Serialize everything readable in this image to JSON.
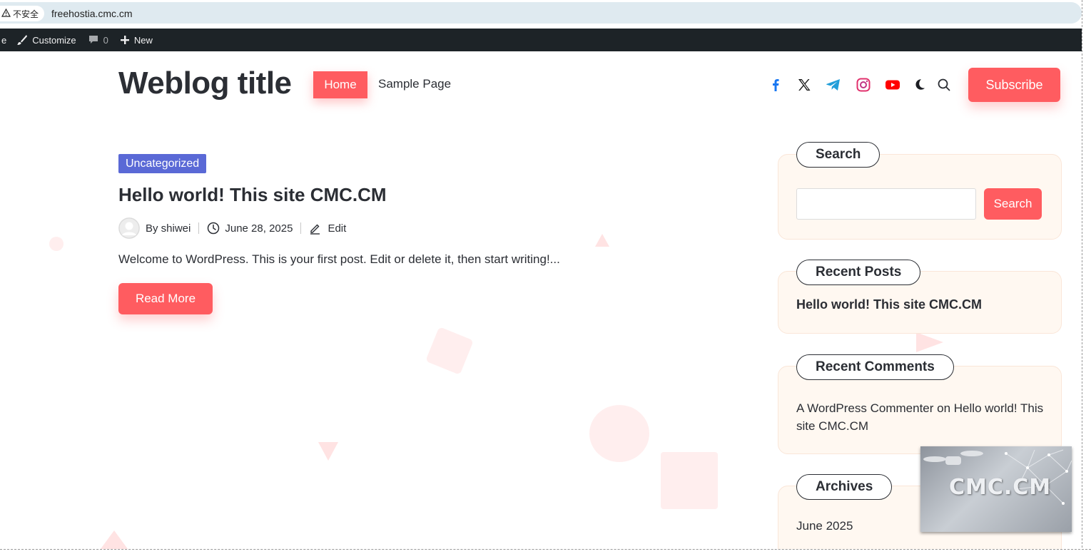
{
  "browser": {
    "security_label": "不安全",
    "url": "freehostia.cmc.cm"
  },
  "admin_bar": {
    "cut_label": "e",
    "customize": "Customize",
    "comments_count": "0",
    "new": "New"
  },
  "header": {
    "site_title": "Weblog title",
    "nav": {
      "home": "Home",
      "sample": "Sample Page"
    },
    "social_icons": [
      "facebook-icon",
      "x-icon",
      "telegram-icon",
      "instagram-icon",
      "youtube-icon",
      "moon-icon",
      "search-icon"
    ],
    "subscribe": "Subscribe",
    "accent_color": "#ff5c60"
  },
  "post": {
    "category": "Uncategorized",
    "category_color": "#5a69d6",
    "title": "Hello world! This site CMC.CM",
    "author": "By shiwei",
    "date": "June 28, 2025",
    "edit": "Edit",
    "excerpt": "Welcome to WordPress. This is your first post. Edit or delete it, then start writing!...",
    "read_more": "Read More"
  },
  "sidebar": {
    "search": {
      "title": "Search",
      "button": "Search",
      "placeholder": ""
    },
    "recent_posts": {
      "title": "Recent Posts",
      "items": [
        "Hello world! This site CMC.CM"
      ]
    },
    "recent_comments": {
      "title": "Recent Comments",
      "author": "A WordPress Commenter",
      "on": " on ",
      "post": "Hello world! This site CMC.CM"
    },
    "archives": {
      "title": "Archives",
      "items": [
        "June 2025"
      ]
    }
  },
  "watermark": {
    "text": "CMC.CM"
  }
}
